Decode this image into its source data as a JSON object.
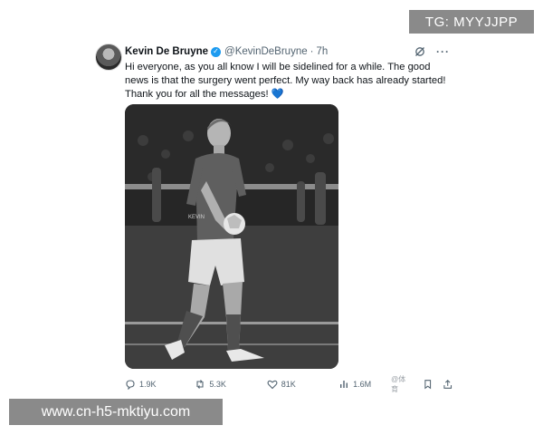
{
  "overlay": {
    "tg_badge": "TG: MYYJJPP",
    "url_banner": "www.cn-h5-mktiyu.com"
  },
  "tweet": {
    "author_name": "Kevin De Bruyne",
    "handle": "@KevinDeBruyne",
    "separator": "·",
    "time": "7h",
    "text": "Hi everyone, as you all know I will be sidelined for a while. The good news is that the surgery went perfect. My way back has already started! Thank you for all the messages!",
    "emoji": "💙",
    "image_alt": "black-and-white photo of footballer holding a ball on the pitch",
    "jersey_text": "KEVIN",
    "counts": {
      "replies": "1.9K",
      "reposts": "5.3K",
      "likes": "81K",
      "views": "1.6M"
    },
    "watermark_small": "@体育"
  }
}
